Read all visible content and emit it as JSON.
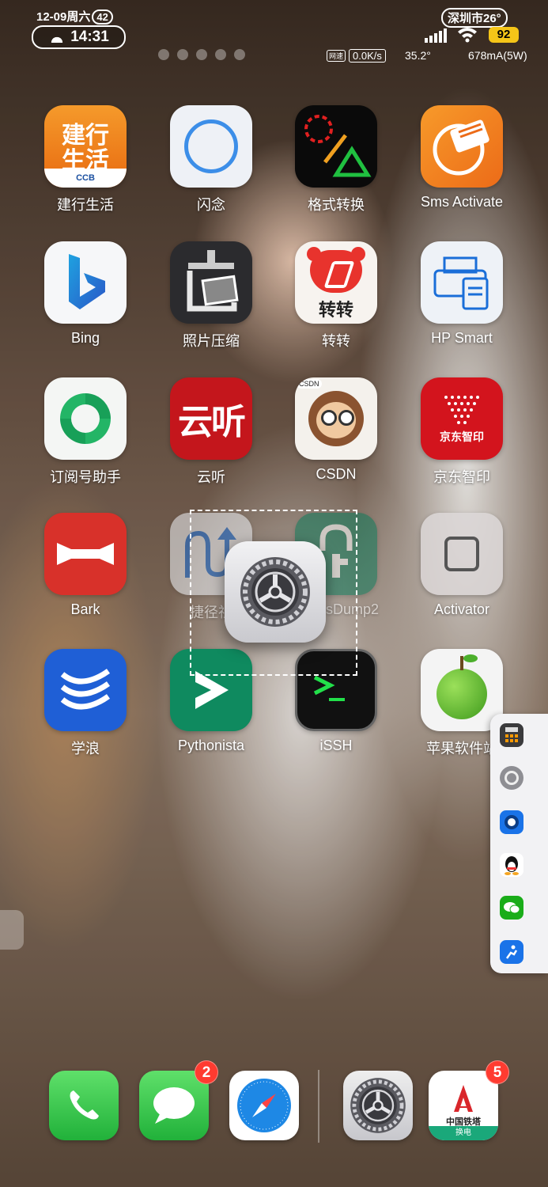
{
  "status": {
    "date": "12-09周六",
    "date_badge": "42",
    "time": "14:31",
    "weather": "深圳市26°",
    "battery": "92",
    "speed_tag": "网速",
    "speed": "0.0K/s",
    "temp": "35.2°",
    "current": "678mA(5W)"
  },
  "apps": [
    {
      "label": "建行生活",
      "icon": "ccb-life-icon"
    },
    {
      "label": "闪念",
      "icon": "ring-icon"
    },
    {
      "label": "格式转换",
      "icon": "format-convert-icon"
    },
    {
      "label": "Sms Activate",
      "icon": "sms-activate-icon"
    },
    {
      "label": "Bing",
      "icon": "bing-icon"
    },
    {
      "label": "照片压缩",
      "icon": "photo-compress-icon"
    },
    {
      "label": "转转",
      "icon": "zhuanzhuan-icon"
    },
    {
      "label": "HP Smart",
      "icon": "printer-icon"
    },
    {
      "label": "订阅号助手",
      "icon": "subscription-helper-icon"
    },
    {
      "label": "云听",
      "icon": "yunting-icon"
    },
    {
      "label": "CSDN",
      "icon": "csdn-icon"
    },
    {
      "label": "京东智印",
      "icon": "jd-print-icon"
    },
    {
      "label": "Bark",
      "icon": "bark-icon"
    },
    {
      "label": "捷径社",
      "icon": "shortcuts-club-icon"
    },
    {
      "label": "TrollStore / IPADump2",
      "label_visible": "sDump2",
      "icon": "lock-icon"
    },
    {
      "label": "Activator",
      "icon": "activator-icon"
    },
    {
      "label": "学浪",
      "icon": "xuelang-icon"
    },
    {
      "label": "Pythonista",
      "icon": "pythonista-icon"
    },
    {
      "label": "iSSH",
      "icon": "terminal-icon"
    },
    {
      "label": "苹果软件站",
      "icon": "green-apple-icon"
    }
  ],
  "icon_text": {
    "ccb_line1": "建行",
    "ccb_line2": "生活",
    "ccb_brand": "CCB",
    "zz": "转转",
    "jd": "京东智印",
    "yun": "云听",
    "csdn_tag": "CSDN"
  },
  "dragging": {
    "icon": "settings-gear-icon"
  },
  "sidebar": [
    {
      "icon": "calculator-icon"
    },
    {
      "icon": "settings-gear-icon"
    },
    {
      "icon": "camera-icon"
    },
    {
      "icon": "qq-penguin-icon"
    },
    {
      "icon": "wechat-icon"
    },
    {
      "icon": "runner-app-icon"
    }
  ],
  "dock": [
    {
      "icon": "phone-icon",
      "badge": ""
    },
    {
      "icon": "messages-icon",
      "badge": "2"
    },
    {
      "icon": "safari-compass-icon",
      "badge": ""
    },
    {
      "icon": "settings-gear-icon",
      "badge": ""
    },
    {
      "icon": "china-tower-icon",
      "badge": "5",
      "text1": "中国铁塔",
      "text2": "换电"
    }
  ],
  "colors": {
    "badge": "#ff3b30",
    "battery": "#f5c518"
  }
}
